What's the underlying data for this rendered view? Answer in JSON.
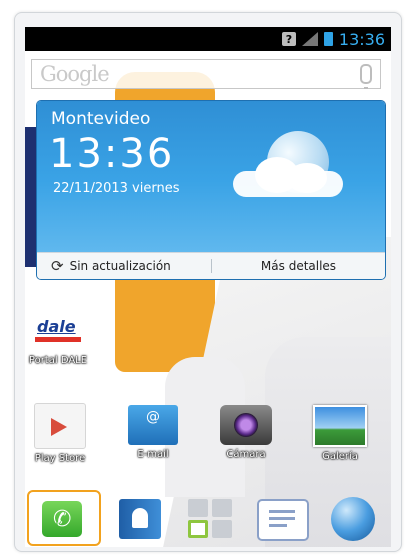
{
  "status_bar": {
    "unknown_badge": "?",
    "time": "13:36"
  },
  "search": {
    "logo": "Google"
  },
  "weather_widget": {
    "city": "Montevideo",
    "time": "13:36",
    "date": "22/11/2013  viernes",
    "refresh_label": "Sin actualización",
    "more_label": "Más detalles"
  },
  "shortcuts": {
    "portal": {
      "label": "Portal DALE",
      "logo_text": "dale"
    },
    "play_store": {
      "label": "Play Store"
    },
    "email": {
      "label": "E-mail"
    },
    "camera": {
      "label": "Cámara"
    },
    "gallery": {
      "label": "Galería"
    }
  },
  "dock": {
    "items": [
      "phone-icon",
      "contacts-icon",
      "apps-icon",
      "messaging-icon",
      "browser-icon"
    ],
    "selected_color": "#f2a21e"
  },
  "colors": {
    "status_time": "#37aef0",
    "widget_top": "#2f8fd5",
    "widget_bottom": "#6ec0f1"
  }
}
